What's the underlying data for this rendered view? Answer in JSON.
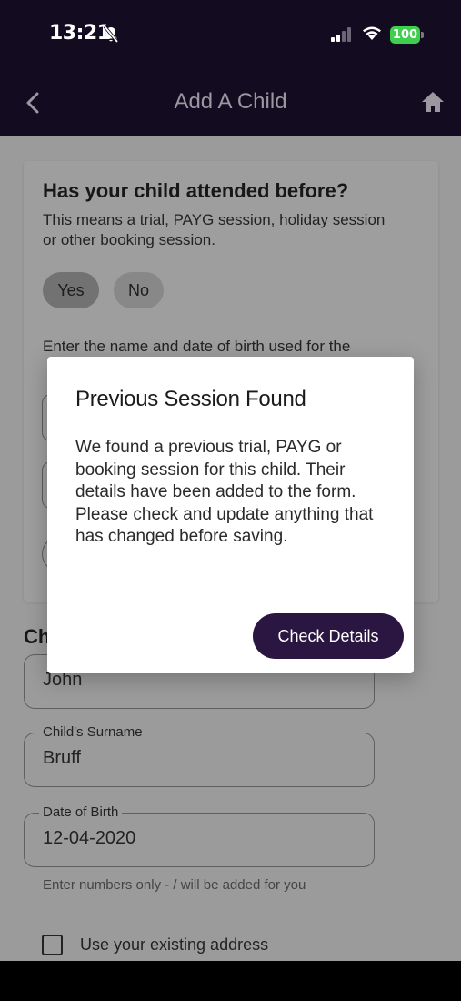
{
  "status_bar": {
    "time": "13:21",
    "battery": "100",
    "icons": [
      "bell-slash-icon",
      "signal-icon",
      "wifi-icon",
      "battery-icon"
    ]
  },
  "app_bar": {
    "title": "Add A Child",
    "back_icon": "chevron-left-icon",
    "home_icon": "home-icon"
  },
  "attended_card": {
    "heading": "Has your child attended before?",
    "description": "This means a trial, PAYG session, holiday session or other booking session.",
    "yes_label": "Yes",
    "no_label": "No",
    "enter_text": "Enter the name and date of birth used for the"
  },
  "child_section": {
    "heading": "Ch",
    "first_name_value": "John",
    "surname_label": "Child's Surname",
    "surname_value": "Bruff",
    "dob_label": "Date of Birth",
    "dob_value": "12-04-2020",
    "dob_helper": "Enter numbers only - / will be added for you",
    "existing_address_label": "Use your existing address"
  },
  "dialog": {
    "title": "Previous Session Found",
    "body": "We found a previous trial, PAYG or booking session for this child. Their details have been added to the form. Please check and update anything that has changed before saving.",
    "button_label": "Check Details"
  },
  "colors": {
    "app_bar_bg": "#130b1f",
    "accent_button": "#2a1640",
    "battery": "#3ecf4e"
  }
}
